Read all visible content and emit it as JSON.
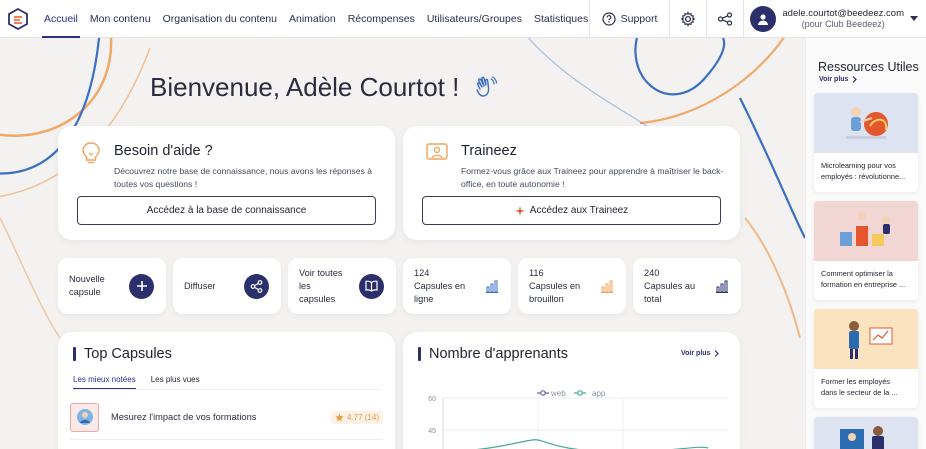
{
  "nav": {
    "items": [
      {
        "label": "Accueil",
        "active": true
      },
      {
        "label": "Mon contenu",
        "active": false
      },
      {
        "label": "Organisation du contenu",
        "active": false
      },
      {
        "label": "Animation",
        "active": false
      },
      {
        "label": "Récompenses",
        "active": false
      },
      {
        "label": "Utilisateurs/Groupes",
        "active": false
      },
      {
        "label": "Statistiques",
        "active": false
      }
    ],
    "support_label": "Support",
    "user_email": "adele.courtot@beedeez.com",
    "user_org": "(pour Club Beedeez)"
  },
  "welcome": {
    "title": "Bienvenue, Adèle Courtot !"
  },
  "help_card": {
    "title": "Besoin d'aide ?",
    "desc": "Découvrez notre base de connaissance, nous avons les réponses à toutes vos questions !",
    "button": "Accédez à la base de connaissance"
  },
  "trainee_card": {
    "title": "Traineez",
    "desc": "Formez-vous grâce aux Traineez pour apprendre à maîtriser le back-office, en toute autonomie !",
    "button": "Accédez aux Traineez"
  },
  "tiles": [
    {
      "label_1": "Nouvelle",
      "label_2": "capsule"
    },
    {
      "label_1": "Diffuser"
    },
    {
      "label_1": "Voir toutes",
      "label_2": "les",
      "label_3": "capsules"
    },
    {
      "count": "124",
      "label_1": "Capsules en",
      "label_2": "ligne"
    },
    {
      "count": "116",
      "label_1": "Capsules en",
      "label_2": "brouillon"
    },
    {
      "count": "240",
      "label_1": "Capsules au",
      "label_2": "total"
    }
  ],
  "top_capsules": {
    "title": "Top Capsules",
    "tabs": [
      "Les mieux notées",
      "Les plus vues"
    ],
    "rows": [
      {
        "name": "Mesurez l'impact de vos formations",
        "score": "4.77 (14)"
      }
    ]
  },
  "learners": {
    "title": "Nombre d'apprenants",
    "see_more": "Voir plus",
    "legend": [
      "web",
      "app"
    ],
    "y_ticks": [
      "60",
      "45"
    ]
  },
  "resources": {
    "title": "Ressources Utiles",
    "see_more": "Voir plus",
    "cards": [
      {
        "text_1": "Microlearning pour vos",
        "text_2": "employés : révolutionne..."
      },
      {
        "text_1": "Comment optimiser la",
        "text_2": "formation en entreprise ..."
      },
      {
        "text_1": "Former les employés",
        "text_2": "dans le secteur de la ..."
      }
    ]
  },
  "colors": {
    "primary": "#2b2f6b",
    "accent_orange": "#f2a35a",
    "accent_blue": "#2b6cb0"
  }
}
